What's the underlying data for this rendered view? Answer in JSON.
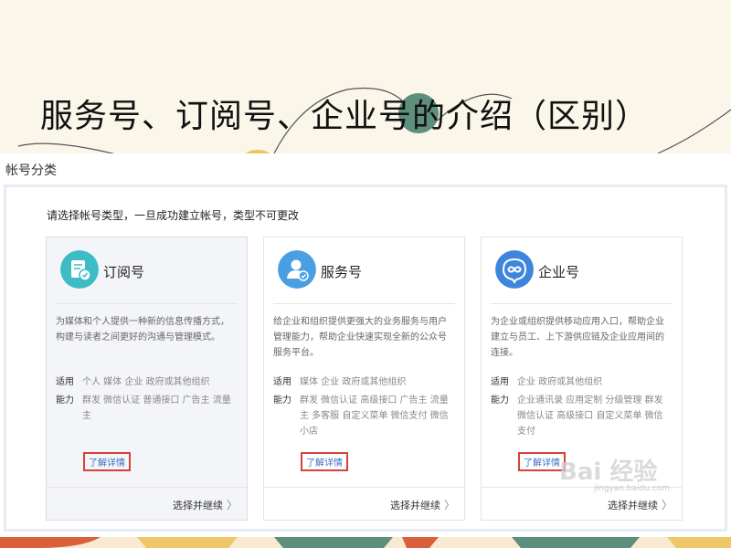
{
  "slide": {
    "title": "服务号、订阅号、企业号的介绍（区别）"
  },
  "screen": {
    "section_label": "帐号分类",
    "instruction": "请选择帐号类型，一旦成功建立帐号，类型不可更改",
    "cards": [
      {
        "title": "订阅号",
        "icon": "subscription-account-icon",
        "icon_color": "#3dbcc6",
        "desc_lines": [
          "为媒体和个人提供一种新的信息传播方式，",
          "构建与读者之间更好的沟通与管理模式。"
        ],
        "apply_key": "适用",
        "apply_lines": [
          "个人 媒体 企业 政府或其他组织"
        ],
        "ability_key": "能力",
        "ability_lines": [
          "群发 微信认证 普通接口 广告主 流量",
          "主"
        ],
        "learn_more": "了解详情",
        "continue": "选择并继续"
      },
      {
        "title": "服务号",
        "icon": "service-account-icon",
        "icon_color": "#4a9fe2",
        "desc_lines": [
          "给企业和组织提供更强大的业务服务与用户",
          "管理能力，帮助企业快速实现全新的公众号",
          "服务平台。"
        ],
        "apply_key": "适用",
        "apply_lines": [
          "媒体 企业 政府或其他组织"
        ],
        "ability_key": "能力",
        "ability_lines": [
          "群发 微信认证 高级接口 广告主 流量",
          "主 多客服 自定义菜单 微信支付 微信",
          "小店"
        ],
        "learn_more": "了解详情",
        "continue": "选择并继续"
      },
      {
        "title": "企业号",
        "icon": "enterprise-account-icon",
        "icon_color": "#3d86dc",
        "desc_lines": [
          "为企业或组织提供移动应用入口，帮助企业",
          "建立与员工、上下游供应链及企业应用间的",
          "连接。"
        ],
        "apply_key": "适用",
        "apply_lines": [
          "企业 政府或其他组织"
        ],
        "ability_key": "能力",
        "ability_lines": [
          "企业通讯录 应用定制 分级管理 群发",
          "微信认证 高级接口 自定义菜单 微信",
          "支付"
        ],
        "learn_more": "了解详情",
        "continue": "选择并继续"
      }
    ],
    "continue_chevron": "〉"
  },
  "watermark": {
    "text": "Bai 经验",
    "subtext": "jingyan.baidu.com"
  }
}
